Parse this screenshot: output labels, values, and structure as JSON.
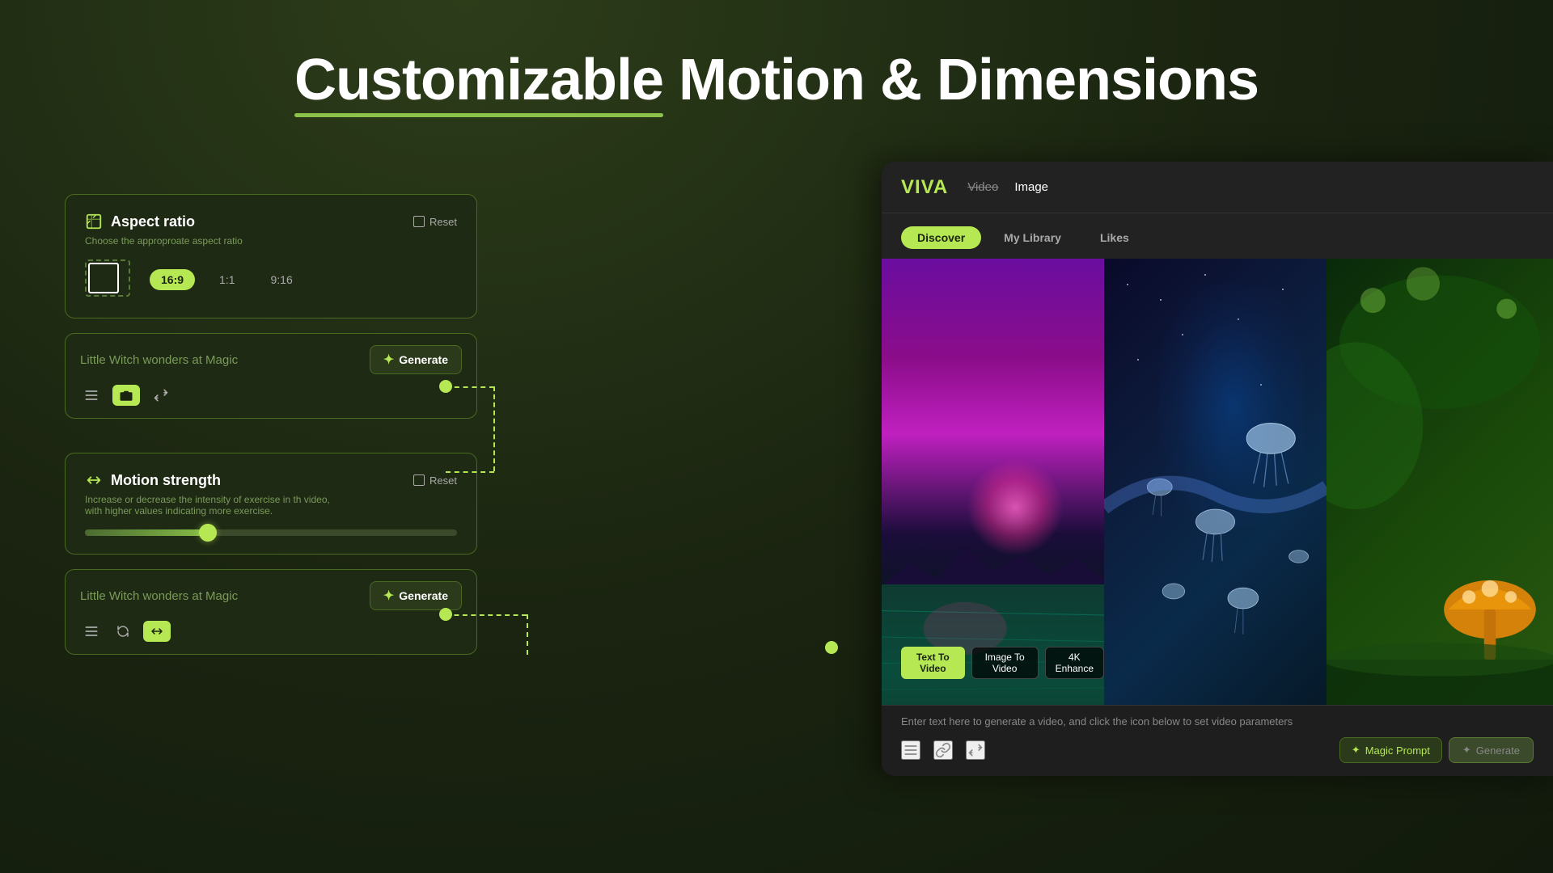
{
  "header": {
    "title_part1": "Customizable",
    "title_part2": " Motion & Dimensions"
  },
  "aspect_ratio_card": {
    "title": "Aspect ratio",
    "subtitle": "Choose the approproate aspect ratio",
    "reset_label": "Reset",
    "ratios": [
      "16:9",
      "1:1",
      "9:16"
    ],
    "active_ratio": "16:9"
  },
  "prompt_card_top": {
    "placeholder": "Little Witch wonders at Magic",
    "generate_label": "Generate"
  },
  "motion_strength_card": {
    "title": "Motion strength",
    "subtitle_line1": "Increase or decrease the intensity of exercise in th video,",
    "subtitle_line2": "with higher values indicating more exercise.",
    "reset_label": "Reset",
    "slider_value": 35
  },
  "prompt_card_bottom": {
    "placeholder": "Little Witch wonders at Magic",
    "generate_label": "Generate"
  },
  "app": {
    "logo": "VIVA",
    "nav_tabs": [
      {
        "label": "Video",
        "state": "strikethrough"
      },
      {
        "label": "Image",
        "state": "active"
      }
    ],
    "discover_tabs": [
      {
        "label": "Discover",
        "state": "active"
      },
      {
        "label": "My Library",
        "state": "inactive"
      },
      {
        "label": "Likes",
        "state": "inactive"
      }
    ],
    "video_tags": [
      {
        "label": "Text To Video",
        "state": "active"
      },
      {
        "label": "Image To Video",
        "state": "inactive"
      },
      {
        "label": "4K Enhance",
        "state": "inactive"
      }
    ],
    "bottom_input_placeholder": "Enter text here to generate a video, and click the icon below to set video parameters",
    "magic_prompt_label": "Magic Prompt",
    "generate_label": "Generate"
  }
}
